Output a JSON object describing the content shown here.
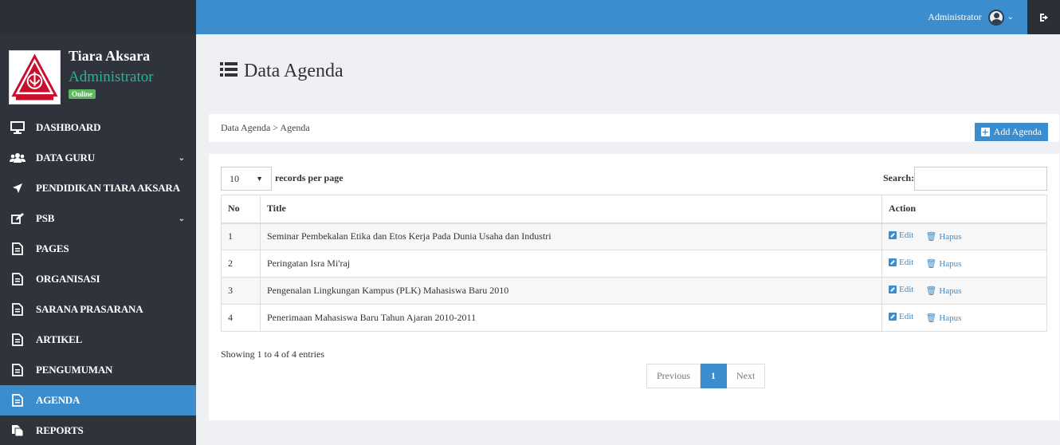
{
  "header": {
    "user_name": "Administrator"
  },
  "profile": {
    "name": "Tiara Aksara",
    "role": "Administrator",
    "status": "Online"
  },
  "sidebar": {
    "items": [
      {
        "label": "DASHBOARD",
        "icon": "monitor-icon"
      },
      {
        "label": "DATA GURU",
        "icon": "users-icon",
        "has_children": true
      },
      {
        "label": "PENDIDIKAN TIARA AKSARA",
        "icon": "location-arrow-icon"
      },
      {
        "label": "PSB",
        "icon": "edit-icon",
        "has_children": true
      },
      {
        "label": "PAGES",
        "icon": "file-icon"
      },
      {
        "label": "ORGANISASI",
        "icon": "file-icon"
      },
      {
        "label": "SARANA PRASARANA",
        "icon": "file-icon"
      },
      {
        "label": "ARTIKEL",
        "icon": "file-icon"
      },
      {
        "label": "PENGUMUMAN",
        "icon": "file-icon"
      },
      {
        "label": "AGENDA",
        "icon": "file-icon",
        "active": true
      },
      {
        "label": "REPORTS",
        "icon": "files-icon"
      }
    ]
  },
  "main": {
    "title": "Data Agenda",
    "breadcrumb": "Data Agenda > Agenda",
    "add_button": "Add Agenda",
    "length_value": "10",
    "length_label": "records per page",
    "search_label": "Search:",
    "search_value": "",
    "columns": [
      "No",
      "Title",
      "Action"
    ],
    "rows": [
      {
        "no": "1",
        "title": "Seminar Pembekalan Etika dan Etos Kerja Pada Dunia Usaha dan Industri"
      },
      {
        "no": "2",
        "title": "Peringatan Isra Mi'raj"
      },
      {
        "no": "3",
        "title": "Pengenalan Lingkungan Kampus (PLK) Mahasiswa Baru 2010"
      },
      {
        "no": "4",
        "title": "Penerimaan Mahasiswa Baru Tahun Ajaran 2010-2011"
      }
    ],
    "edit_label": "Edit",
    "delete_label": "Hapus",
    "info": "Showing 1 to 4 of 4 entries",
    "pager": {
      "previous": "Previous",
      "current": "1",
      "next": "Next"
    }
  },
  "colors": {
    "primary": "#3c8dcd",
    "sidebar_bg": "#2f343c",
    "topbar_dark": "#2b2f36",
    "role_green": "#1fb79b",
    "online_badge": "#5cb85c"
  }
}
